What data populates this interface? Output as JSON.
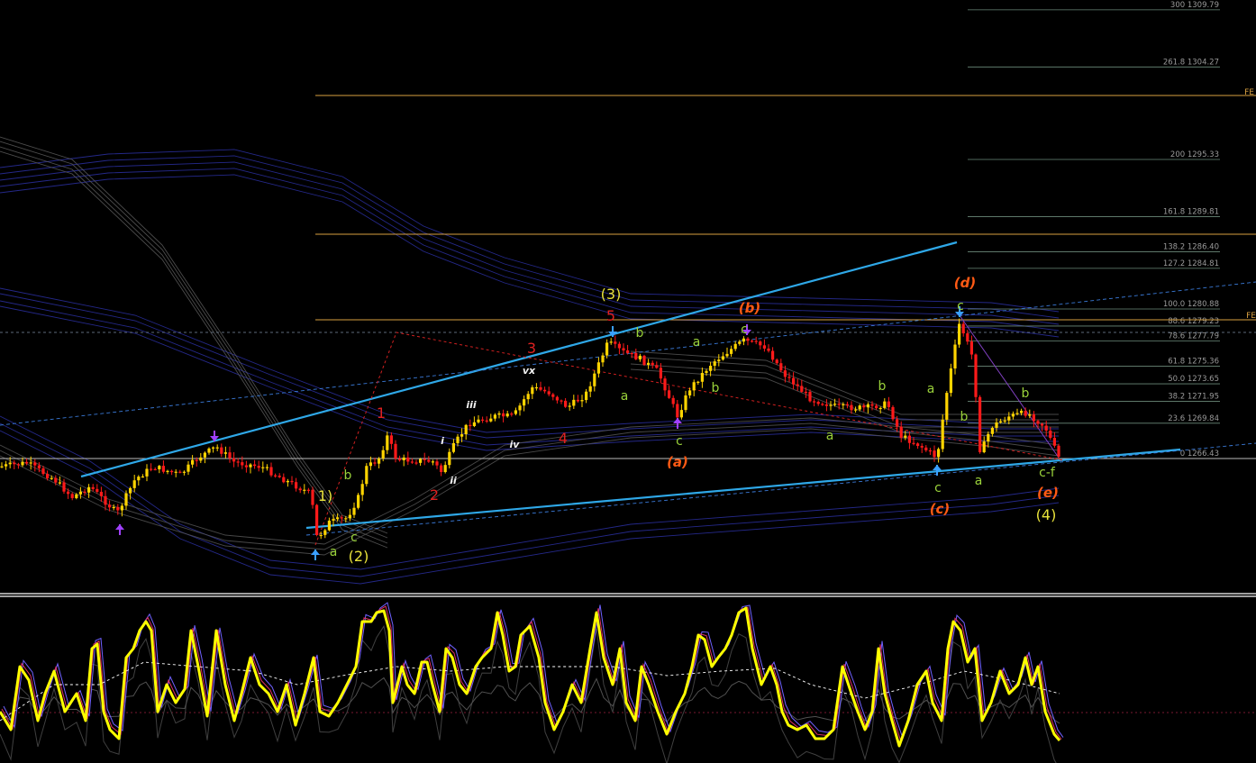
{
  "chart_data": {
    "type": "candlestick",
    "price_range": [
      1257.5,
      1312.0
    ],
    "fib_levels": [
      {
        "pct": "300",
        "price": "1309.79"
      },
      {
        "pct": "261.8",
        "price": "1304.27"
      },
      {
        "pct": "200",
        "price": "1295.33"
      },
      {
        "pct": "161.8",
        "price": "1289.81"
      },
      {
        "pct": "138.2",
        "price": "1286.40"
      },
      {
        "pct": "127.2",
        "price": "1284.81"
      },
      {
        "pct": "100.0",
        "price": "1280.88"
      },
      {
        "pct": "88.6",
        "price": "1279.23"
      },
      {
        "pct": "78.6",
        "price": "1277.79"
      },
      {
        "pct": "61.8",
        "price": "1275.36"
      },
      {
        "pct": "50.0",
        "price": "1273.65"
      },
      {
        "pct": "38.2",
        "price": "1271.95"
      },
      {
        "pct": "23.6",
        "price": "1269.84"
      },
      {
        "pct": "0",
        "price": "1266.43"
      }
    ],
    "fe_labels": [
      "FE",
      "FE"
    ],
    "wave_labels": [
      {
        "text": "1)",
        "color": "#e8e23a",
        "size": 16
      },
      {
        "text": "(2)",
        "color": "#e8e23a",
        "size": 16
      },
      {
        "text": "(3)",
        "color": "#e8e23a",
        "size": 16
      },
      {
        "text": "(4)",
        "color": "#e8e23a",
        "size": 16
      },
      {
        "text": "1",
        "color": "#e02020",
        "size": 16
      },
      {
        "text": "2",
        "color": "#e02020",
        "size": 16
      },
      {
        "text": "3",
        "color": "#e02020",
        "size": 16
      },
      {
        "text": "4",
        "color": "#e02020",
        "size": 16
      },
      {
        "text": "5",
        "color": "#e02020",
        "size": 16
      },
      {
        "text": "(a)",
        "color": "#ff5a14",
        "size": 15,
        "italic": true,
        "bold": true
      },
      {
        "text": "(b)",
        "color": "#ff5a14",
        "size": 15,
        "italic": true,
        "bold": true
      },
      {
        "text": "(c)",
        "color": "#ff5a14",
        "size": 15,
        "italic": true,
        "bold": true
      },
      {
        "text": "(d)",
        "color": "#ff5a14",
        "size": 15,
        "italic": true,
        "bold": true
      },
      {
        "text": "(e)",
        "color": "#ff5a14",
        "size": 15,
        "italic": true,
        "bold": true
      },
      {
        "text": "a",
        "color": "#9ad23a",
        "size": 14
      },
      {
        "text": "b",
        "color": "#9ad23a",
        "size": 14
      },
      {
        "text": "c",
        "color": "#9ad23a",
        "size": 14
      },
      {
        "text": "b",
        "color": "#9ad23a",
        "size": 14
      },
      {
        "text": "a",
        "color": "#9ad23a",
        "size": 14
      },
      {
        "text": "c",
        "color": "#9ad23a",
        "size": 14
      },
      {
        "text": "a",
        "color": "#9ad23a",
        "size": 14
      },
      {
        "text": "b",
        "color": "#9ad23a",
        "size": 14
      },
      {
        "text": "c",
        "color": "#9ad23a",
        "size": 14
      },
      {
        "text": "a",
        "color": "#9ad23a",
        "size": 14
      },
      {
        "text": "b",
        "color": "#9ad23a",
        "size": 14
      },
      {
        "text": "c",
        "color": "#9ad23a",
        "size": 14
      },
      {
        "text": "a",
        "color": "#9ad23a",
        "size": 14
      },
      {
        "text": "b",
        "color": "#9ad23a",
        "size": 14
      },
      {
        "text": "c",
        "color": "#9ad23a",
        "size": 14
      },
      {
        "text": "a",
        "color": "#9ad23a",
        "size": 14
      },
      {
        "text": "b",
        "color": "#9ad23a",
        "size": 14
      },
      {
        "text": "c-f",
        "color": "#9ad23a",
        "size": 14
      },
      {
        "text": "i",
        "color": "#f0f0f0",
        "size": 11,
        "italic": true,
        "bold": true
      },
      {
        "text": "ii",
        "color": "#f0f0f0",
        "size": 11,
        "italic": true,
        "bold": true
      },
      {
        "text": "iii",
        "color": "#f0f0f0",
        "size": 11,
        "italic": true,
        "bold": true
      },
      {
        "text": "iv",
        "color": "#f0f0f0",
        "size": 11,
        "italic": true,
        "bold": true
      },
      {
        "text": "vx",
        "color": "#f0f0f0",
        "size": 11,
        "italic": true,
        "bold": true
      }
    ],
    "colors": {
      "background": "#000000",
      "up_candle": "#ffd400",
      "down_candle": "#ff1a1a",
      "trendline": "#2fa8e8",
      "fib_line": "#6b8a7a",
      "fe_line": "#d8a040",
      "oscillator_main": "#ffff00",
      "oscillator_sig1": "#7060ff",
      "oscillator_sig2": "#e03060",
      "oscillator_dashed": "#ffffff"
    }
  }
}
